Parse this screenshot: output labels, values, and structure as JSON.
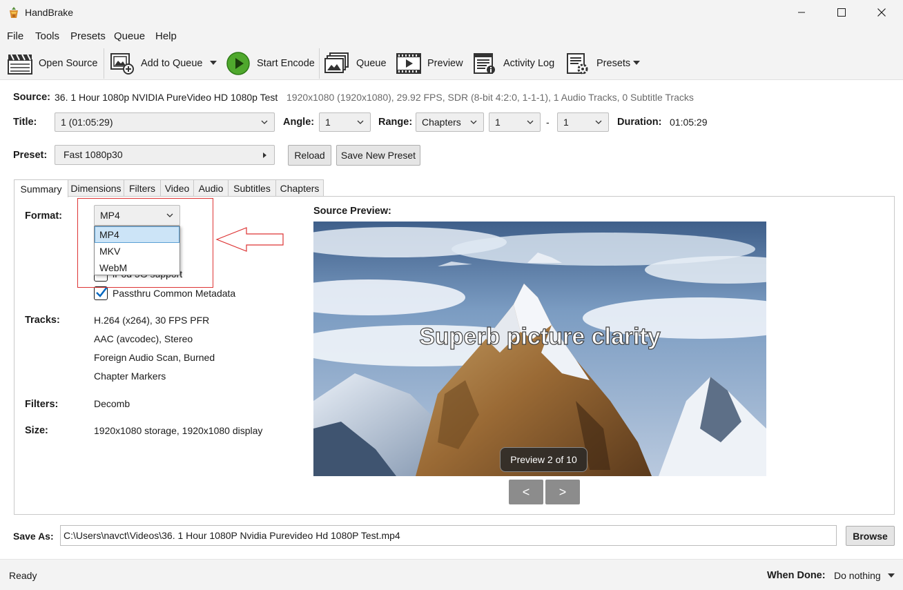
{
  "window": {
    "title": "HandBrake"
  },
  "menu": {
    "items": [
      "File",
      "Tools",
      "Presets",
      "Queue",
      "Help"
    ]
  },
  "toolbar": {
    "open_source": "Open Source",
    "add_to_queue": "Add to Queue",
    "start_encode": "Start Encode",
    "queue": "Queue",
    "preview": "Preview",
    "activity_log": "Activity Log",
    "presets": "Presets"
  },
  "source": {
    "label": "Source:",
    "name": "36. 1 Hour 1080p NVIDIA PureVideo HD 1080p Test",
    "info": "1920x1080 (1920x1080), 29.92 FPS, SDR (8-bit 4:2:0, 1-1-1), 1 Audio Tracks, 0 Subtitle Tracks"
  },
  "title_row": {
    "title_label": "Title:",
    "title_value": "1  (01:05:29)",
    "angle_label": "Angle:",
    "angle_value": "1",
    "range_label": "Range:",
    "range_value": "Chapters",
    "range_start": "1",
    "range_sep": "-",
    "range_end": "1",
    "duration_label": "Duration:",
    "duration_value": "01:05:29"
  },
  "preset_row": {
    "preset_label": "Preset:",
    "preset_value": "Fast 1080p30",
    "reload": "Reload",
    "save_new": "Save New Preset"
  },
  "tabs": [
    "Summary",
    "Dimensions",
    "Filters",
    "Video",
    "Audio",
    "Subtitles",
    "Chapters"
  ],
  "summary": {
    "format_label": "Format:",
    "format_value": "MP4",
    "format_options": [
      "MP4",
      "MKV",
      "WebM"
    ],
    "ipod_label": "iPod 5G support",
    "passthru_label": "Passthru Common Metadata",
    "tracks_label": "Tracks:",
    "tracks": [
      "H.264 (x264), 30 FPS PFR",
      "AAC (avcodec), Stereo",
      "Foreign Audio Scan, Burned",
      "Chapter Markers"
    ],
    "filters_label": "Filters:",
    "filters_value": "Decomb",
    "size_label": "Size:",
    "size_value": "1920x1080 storage, 1920x1080 display"
  },
  "preview": {
    "label": "Source Preview:",
    "overlay_text": "Superb picture clarity",
    "badge": "Preview 2 of 10",
    "prev": "<",
    "next": ">"
  },
  "save_as": {
    "label": "Save As:",
    "path": "C:\\Users\\navct\\Videos\\36. 1 Hour 1080P Nvidia Purevideo Hd 1080P Test.mp4",
    "browse": "Browse"
  },
  "status": {
    "text": "Ready",
    "when_done_label": "When Done:",
    "when_done_value": "Do nothing"
  },
  "colors": {
    "annotation_red": "#dd3333",
    "selection_blue": "#cce4f7",
    "checkbox_blue": "#0067c0"
  }
}
